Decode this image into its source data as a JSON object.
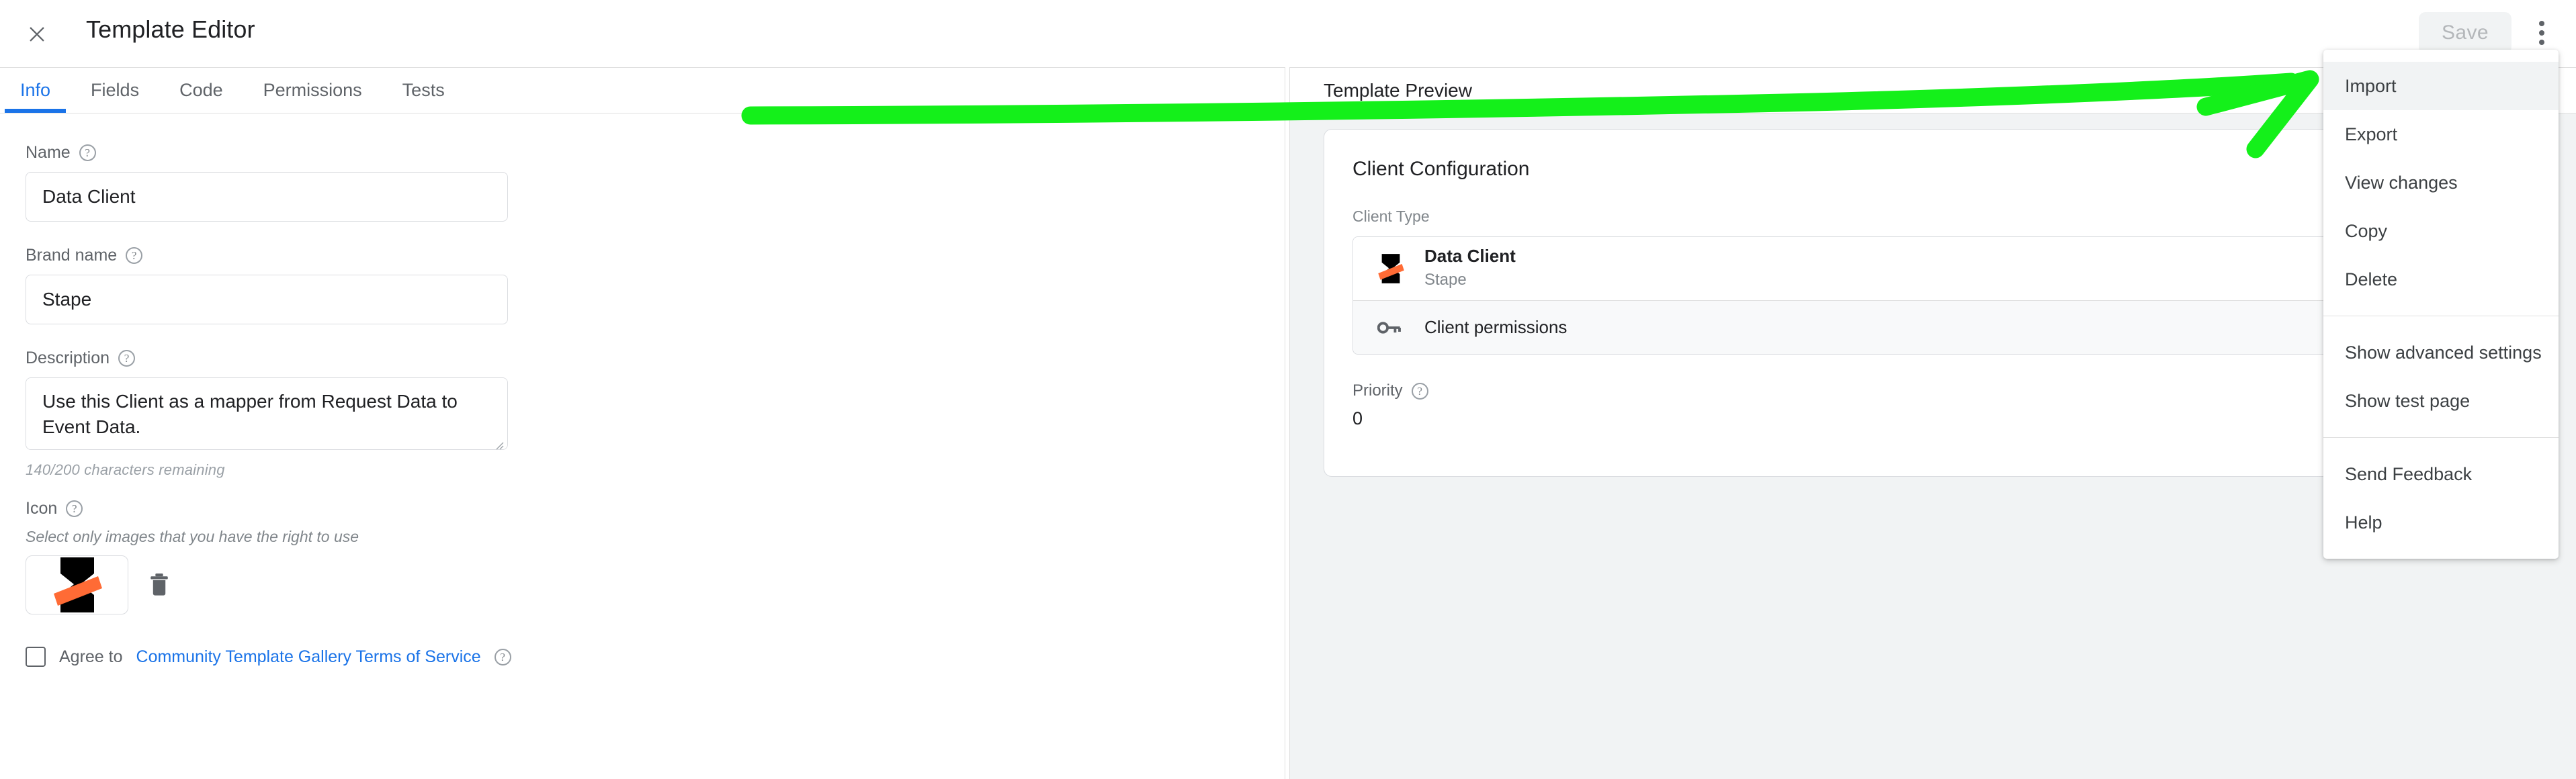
{
  "topbar": {
    "close_icon": "close-icon",
    "title": "Template Editor",
    "save_label": "Save",
    "menu_icon": "more-vert-icon"
  },
  "tabs": [
    {
      "label": "Info",
      "active": true
    },
    {
      "label": "Fields",
      "active": false
    },
    {
      "label": "Code",
      "active": false
    },
    {
      "label": "Permissions",
      "active": false
    },
    {
      "label": "Tests",
      "active": false
    }
  ],
  "editor": {
    "name": {
      "label": "Name",
      "value": "Data Client",
      "help": "?"
    },
    "brand": {
      "label": "Brand name",
      "value": "Stape",
      "help": "?"
    },
    "description": {
      "label": "Description",
      "value": "Use this Client as a mapper from Request Data to Event Data.",
      "counter": "140/200 characters remaining",
      "help": "?"
    },
    "icon": {
      "label": "Icon",
      "help": "?",
      "hint": "Select only images that you have the right to use",
      "thumb_icon": "stape-logo-icon",
      "delete_icon": "trash-icon"
    },
    "agree": {
      "prefix": "Agree to",
      "link": "Community Template Gallery Terms of Service",
      "help": "?",
      "checked": false
    }
  },
  "preview": {
    "title": "Template Preview",
    "card": {
      "title": "Client Configuration",
      "client_type_label": "Client Type",
      "rows": [
        {
          "icon": "stape-logo-icon",
          "name": "Data Client",
          "sub": "Stape",
          "type": "client"
        },
        {
          "icon": "key-icon",
          "name": "Client permissions",
          "type": "permissions"
        }
      ],
      "priority_label": "Priority",
      "priority_help": "?",
      "priority_value": "0"
    }
  },
  "menu": {
    "items": [
      {
        "label": "Import",
        "hovered": true
      },
      {
        "label": "Export",
        "hovered": false
      },
      {
        "label": "View changes",
        "hovered": false
      },
      {
        "label": "Copy",
        "hovered": false
      },
      {
        "label": "Delete",
        "hovered": false
      },
      {
        "separator": true
      },
      {
        "label": "Show advanced settings",
        "hovered": false
      },
      {
        "label": "Show test page",
        "hovered": false
      },
      {
        "separator": true
      },
      {
        "label": "Send Feedback",
        "hovered": false
      },
      {
        "label": "Help",
        "hovered": false
      }
    ]
  },
  "annotation": {
    "arrow_color": "#14f01a",
    "target": "Import"
  },
  "colors": {
    "accent_blue": "#1a73e8",
    "brand_orange": "#ff6b35",
    "text_primary": "#202124",
    "text_secondary": "#5f6368",
    "panel_bg": "#f1f3f4"
  }
}
